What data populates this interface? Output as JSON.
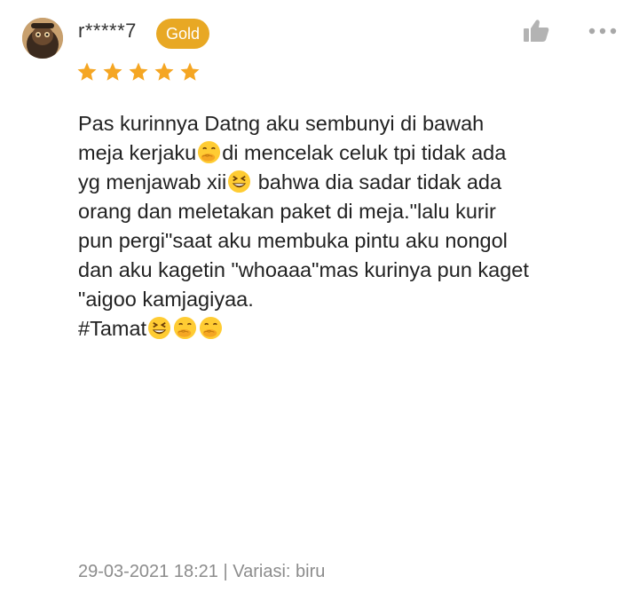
{
  "review": {
    "user": {
      "name": "r*****7",
      "badge": "Gold",
      "badge_color": "#e8a824"
    },
    "rating": {
      "value": 5,
      "max": 5,
      "star_color": "#f5a623"
    },
    "actions": {
      "like_icon": "thumbs-up-icon",
      "more_icon": "more-dots-icon"
    },
    "text_lines": [
      "Pas kurinnya Datng aku sembunyi di bawah",
      [
        "meja kerjaku",
        "di mencelak celuk tpi tidak ada"
      ],
      [
        "yg menjawab xii",
        " bahwa dia sadar tidak ada"
      ],
      "orang dan meletakan paket di meja.\"lalu kurir",
      "pun pergi\"saat aku membuka pintu aku nongol",
      "dan aku kagetin \"whoaaa\"mas kurinya pun kaget",
      "\"aigoo kamjagiyaa.",
      "#Tamat"
    ],
    "footer": {
      "date": "29-03-2021 18:21",
      "separator": "|",
      "variant_label": "Variasi:",
      "variant_value": "biru"
    }
  }
}
